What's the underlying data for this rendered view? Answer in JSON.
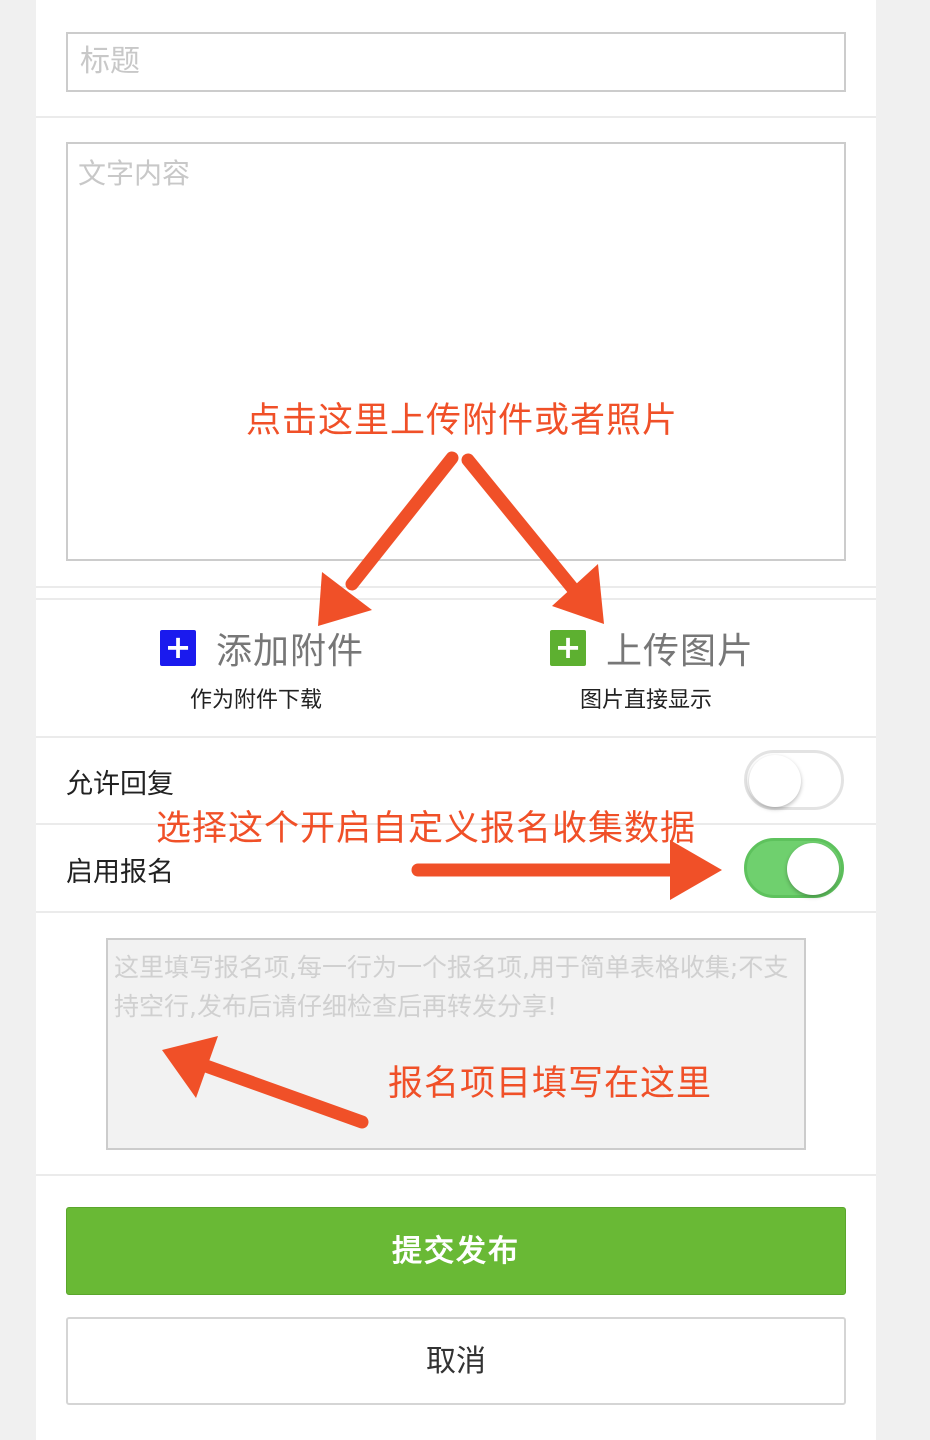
{
  "form": {
    "title_placeholder": "标题",
    "content_placeholder": "文字内容"
  },
  "uploads": {
    "attachment": {
      "label": "添加附件",
      "sub": "作为附件下载",
      "icon": "plus-icon",
      "color": "#1a1aee"
    },
    "image": {
      "label": "上传图片",
      "sub": "图片直接显示",
      "icon": "plus-icon",
      "color": "#5db030"
    }
  },
  "settings": {
    "allow_reply": {
      "label": "允许回复",
      "on": false
    },
    "enable_signup": {
      "label": "启用报名",
      "on": true
    }
  },
  "signup_items_placeholder": "这里填写报名项,每一行为一个报名项,用于简单表格收集;不支持空行,发布后请仔细检查后再转发分享!",
  "buttons": {
    "submit": "提交发布",
    "cancel": "取消"
  },
  "annotations": {
    "upload_hint": "点击这里上传附件或者照片",
    "signup_hint": "选择这个开启自定义报名收集数据",
    "items_hint": "报名项目填写在这里"
  },
  "colors": {
    "annotation": "#f05028",
    "toggle_on": "#6fd06e",
    "submit": "#69b935"
  }
}
